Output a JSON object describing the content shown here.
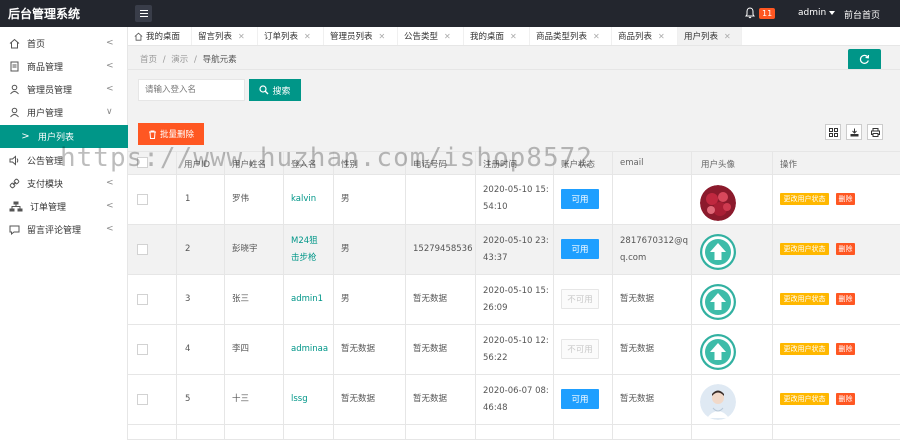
{
  "app": {
    "title": "后台管理系统",
    "notification_count": "11",
    "admin_label": "admin",
    "front_link": "前台首页"
  },
  "sidebar": {
    "items": [
      {
        "label": "首页",
        "icon": "home-icon"
      },
      {
        "label": "商品管理",
        "icon": "file-icon"
      },
      {
        "label": "管理员管理",
        "icon": "user-icon"
      },
      {
        "label": "用户管理",
        "icon": "user-icon"
      },
      {
        "label": "用户列表",
        "icon": "chevron-right-icon"
      },
      {
        "label": "公告管理",
        "icon": "speaker-icon"
      },
      {
        "label": "支付模块",
        "icon": "link-icon"
      },
      {
        "label": "订单管理",
        "icon": "sitemap-icon"
      },
      {
        "label": "留言评论管理",
        "icon": "chat-icon"
      }
    ]
  },
  "tabs": [
    {
      "label": "我的桌面"
    },
    {
      "label": "留言列表"
    },
    {
      "label": "订单列表"
    },
    {
      "label": "管理员列表"
    },
    {
      "label": "公告类型"
    },
    {
      "label": "我的桌面"
    },
    {
      "label": "商品类型列表"
    },
    {
      "label": "商品列表"
    },
    {
      "label": "用户列表"
    }
  ],
  "breadcrumb": {
    "home": "首页",
    "sep": "/",
    "demo": "演示",
    "current": "导航元素"
  },
  "search": {
    "placeholder": "请输入登入名",
    "button_label": "搜索"
  },
  "toolbar": {
    "batch_delete_label": "批量删除"
  },
  "table": {
    "headers": [
      "用户ID",
      "用户姓名",
      "登入名",
      "性别",
      "电话号码",
      "注册时间",
      "账户状态",
      "email",
      "用户头像",
      "操作"
    ],
    "rows": [
      {
        "id": "1",
        "name": "罗伟",
        "login": "kalvin",
        "login2": "",
        "gender": "男",
        "phone": "",
        "time1": "2020-05-10 15:",
        "time2": "54:10",
        "status": "可用",
        "enabled": true,
        "email1": "",
        "email2": "",
        "avatar": "photo-red"
      },
      {
        "id": "2",
        "name": "彭晓宇",
        "login": "M24狙",
        "login2": "击步枪",
        "gender": "男",
        "phone": "15279458536",
        "time1": "2020-05-10 23:",
        "time2": "43:37",
        "status": "可用",
        "enabled": true,
        "email1": "2817670312@q",
        "email2": "q.com",
        "avatar": "upload-icon"
      },
      {
        "id": "3",
        "name": "张三",
        "login": "admin1",
        "login2": "",
        "gender": "男",
        "phone": "暂无数据",
        "time1": "2020-05-10 15:",
        "time2": "26:09",
        "status": "不可用",
        "enabled": false,
        "email1": "暂无数据",
        "email2": "",
        "avatar": "upload-icon"
      },
      {
        "id": "4",
        "name": "李四",
        "login": "adminaa",
        "login2": "",
        "gender": "暂无数据",
        "phone": "暂无数据",
        "time1": "2020-05-10 12:",
        "time2": "56:22",
        "status": "不可用",
        "enabled": false,
        "email1": "暂无数据",
        "email2": "",
        "avatar": "upload-icon"
      },
      {
        "id": "5",
        "name": "十三",
        "login": "lssg",
        "login2": "",
        "gender": "暂无数据",
        "phone": "暂无数据",
        "time1": "2020-06-07 08:",
        "time2": "46:48",
        "status": "可用",
        "enabled": true,
        "email1": "暂无数据",
        "email2": "",
        "avatar": "photo-person"
      }
    ],
    "op_edit_label": "更改用户状态",
    "op_delete_label": "删除"
  },
  "watermark": "https://www.huzhan.com/ishop8572",
  "colors": {
    "topbar": "#23262e",
    "accent": "#009688",
    "danger": "#ff5722",
    "warn": "#ffb800",
    "info": "#1e9fff"
  }
}
